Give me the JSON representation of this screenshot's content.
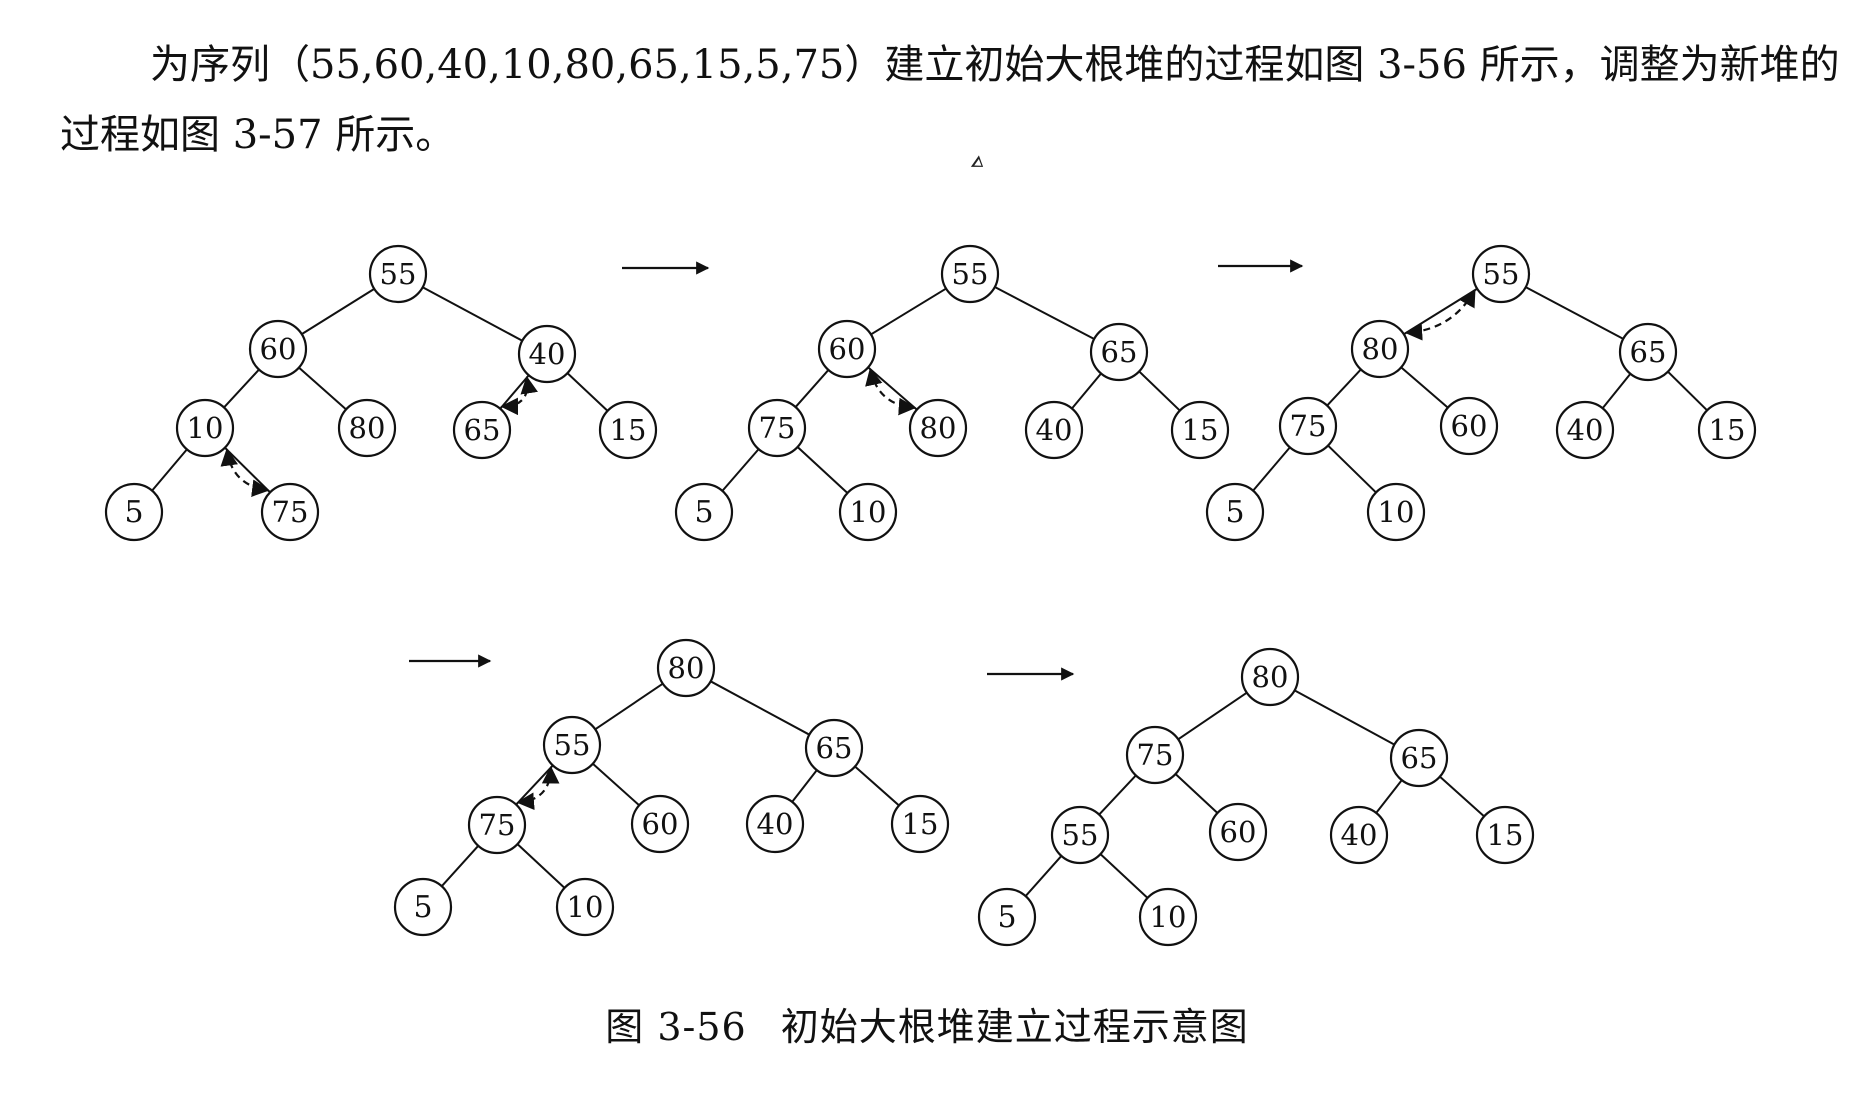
{
  "paragraph": {
    "line1": "为序列（55,60,40,10,80,65,15,5,75）建立初始大根堆的过程如图 3-56 所示，调整为新堆的",
    "line2": "过程如图 3-57 所示。"
  },
  "figure": {
    "caption_number": "图 3-56",
    "caption_text": "初始大根堆建立过程示意图",
    "trees": [
      {
        "id": "step1",
        "nodes": [
          "55",
          "60",
          "40",
          "10",
          "80",
          "65",
          "15",
          "5",
          "75"
        ],
        "swaps": [
          [
            3,
            8
          ],
          [
            2,
            5
          ]
        ]
      },
      {
        "id": "step2",
        "nodes": [
          "55",
          "60",
          "65",
          "75",
          "80",
          "40",
          "15",
          "5",
          "10"
        ],
        "swaps": [
          [
            1,
            4
          ]
        ]
      },
      {
        "id": "step3",
        "nodes": [
          "55",
          "80",
          "65",
          "75",
          "60",
          "40",
          "15",
          "5",
          "10"
        ],
        "swaps": [
          [
            0,
            1
          ]
        ]
      },
      {
        "id": "step4",
        "nodes": [
          "80",
          "55",
          "65",
          "75",
          "60",
          "40",
          "15",
          "5",
          "10"
        ],
        "swaps": [
          [
            1,
            3
          ]
        ]
      },
      {
        "id": "step5",
        "nodes": [
          "80",
          "75",
          "65",
          "55",
          "60",
          "40",
          "15",
          "5",
          "10"
        ],
        "swaps": []
      }
    ]
  }
}
